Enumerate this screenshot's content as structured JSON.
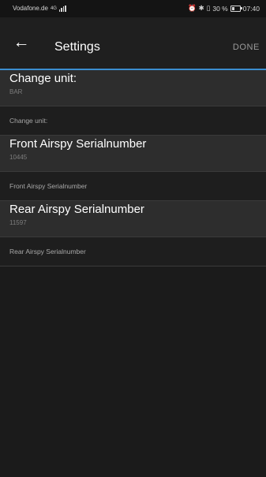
{
  "status_bar": {
    "carrier": "Vodafone.de",
    "network_badge": "4G",
    "icons": [
      "alarm-icon",
      "bluetooth-icon",
      "vibrate-icon"
    ],
    "battery": "30 %",
    "time": "07:40"
  },
  "app_bar": {
    "back_icon": "arrow-left-icon",
    "title": "Settings",
    "done_label": "DONE"
  },
  "accent_color": "#3b8ed0",
  "preferences": [
    {
      "title": "Change unit:",
      "value": "BAR",
      "hint": "Change unit:"
    },
    {
      "title": "Front Airspy Serialnumber",
      "value": "10445",
      "hint": "Front Airspy Serialnumber"
    },
    {
      "title": "Rear Airspy Serialnumber",
      "value": "11597",
      "hint": "Rear Airspy Serialnumber"
    }
  ]
}
